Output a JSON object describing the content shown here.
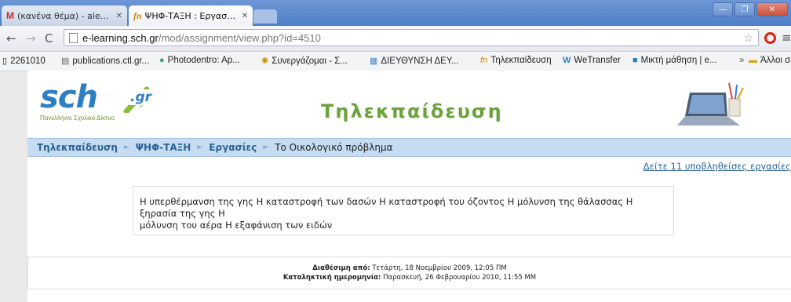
{
  "browser": {
    "tabs": [
      {
        "favicon": "M",
        "title": "(κανένα θέμα) - alexgi",
        "active": false
      },
      {
        "favicon": "fn",
        "title": "ΨΗΦ-ΤΑΞΗ : Εργασία:",
        "active": true
      }
    ],
    "address": {
      "host": "e-learning.sch.gr",
      "path": "/mod/assignment/view.php?id=4510"
    },
    "bookmarks": [
      {
        "icon": "page-icon",
        "label": "2261010"
      },
      {
        "icon": "doc-icon",
        "label": "publications.ctl.gr..."
      },
      {
        "icon": "globe-icon",
        "label": "Photodentro: Ap..."
      },
      {
        "icon": "swirl-icon",
        "label": "Συνεργάζομαι - Σ..."
      },
      {
        "icon": "grid-icon",
        "label": "ΔΙΕΥΘΥΝΣΗ ΔΕΥ..."
      },
      {
        "icon": "fn-icon",
        "label": "Τηλεκπαίδευση"
      },
      {
        "icon": "wetransfer-icon",
        "label": "WeTransfer"
      },
      {
        "icon": "square-icon",
        "label": "Μικτή μάθηση | e..."
      }
    ],
    "bookmarks_overflow": "»",
    "other_bookmarks": "Άλλοι σελιδοδείκτες",
    "colors": {
      "titlebar": "#5a87cd",
      "accent": "#2a6496"
    }
  },
  "header": {
    "logo_main": "sch",
    "logo_suffix": ".gr",
    "logo_tagline": "Πανελλήνιο Σχολικό Δίκτυο",
    "site_title": "Τηλεκπαίδευση"
  },
  "breadcrumb": {
    "items": [
      "Τηλεκπαίδευση",
      "ΨΗΦ-ΤΑΞΗ",
      "Εργασίες"
    ],
    "separator": "►",
    "current": "Το Οικολογικό πρόβλημα"
  },
  "submissions_link": "Δείτε 11 υποβληθείσες εργασίες",
  "description": {
    "line1": "Η υπερθέρμανση της γης Η καταστροφή των δασών Η καταστροφή του όζοντος Η μόλυνση της θάλασσας Η ξηρασία της γης Η",
    "line2": "μόλυνση του αέρα Η εξαφάνιση των ειδών"
  },
  "dates": {
    "available_label": "Διαθέσιμη από:",
    "available_value": "Τετάρτη, 18 Νοεμβρίου 2009, 12:05 ΠΜ",
    "due_label": "Καταληκτική ημερομηνία:",
    "due_value": "Παρασκευή, 26 Φεβρουαρίου 2010, 11:55 ΜΜ"
  }
}
